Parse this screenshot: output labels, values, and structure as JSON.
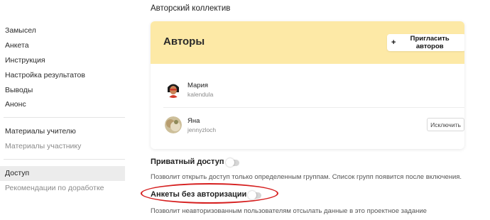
{
  "sidebar": {
    "group1": [
      "Замысел",
      "Анкета",
      "Инструкция",
      "Настройка результатов",
      "Выводы",
      "Анонс"
    ],
    "group2": [
      "Материалы учителю",
      "Материалы участнику"
    ],
    "group3": [
      "Доступ",
      "Рекомендации по доработке"
    ]
  },
  "section": {
    "title": "Авторский коллектив"
  },
  "authors_card": {
    "title": "Авторы",
    "invite_label": "Пригласить авторов",
    "authors": [
      {
        "name": "Мария",
        "login": "kalendula"
      },
      {
        "name": "Яна",
        "login": "jennyzloch",
        "exclude_label": "Исключить"
      }
    ]
  },
  "settings": {
    "private_access": {
      "label": "Приватный доступ",
      "on": false,
      "description": "Позволит открыть доступ только определенным группам. Список групп появится после включения."
    },
    "anonymous_forms": {
      "label": "Анкеты без авторизации",
      "on": false,
      "description": "Позволит неавторизованным пользователям отсылать данные в это проектное задание"
    }
  },
  "colors": {
    "card_header": "#fde9a6",
    "highlight": "#d62020",
    "active_nav": "#ececec"
  }
}
